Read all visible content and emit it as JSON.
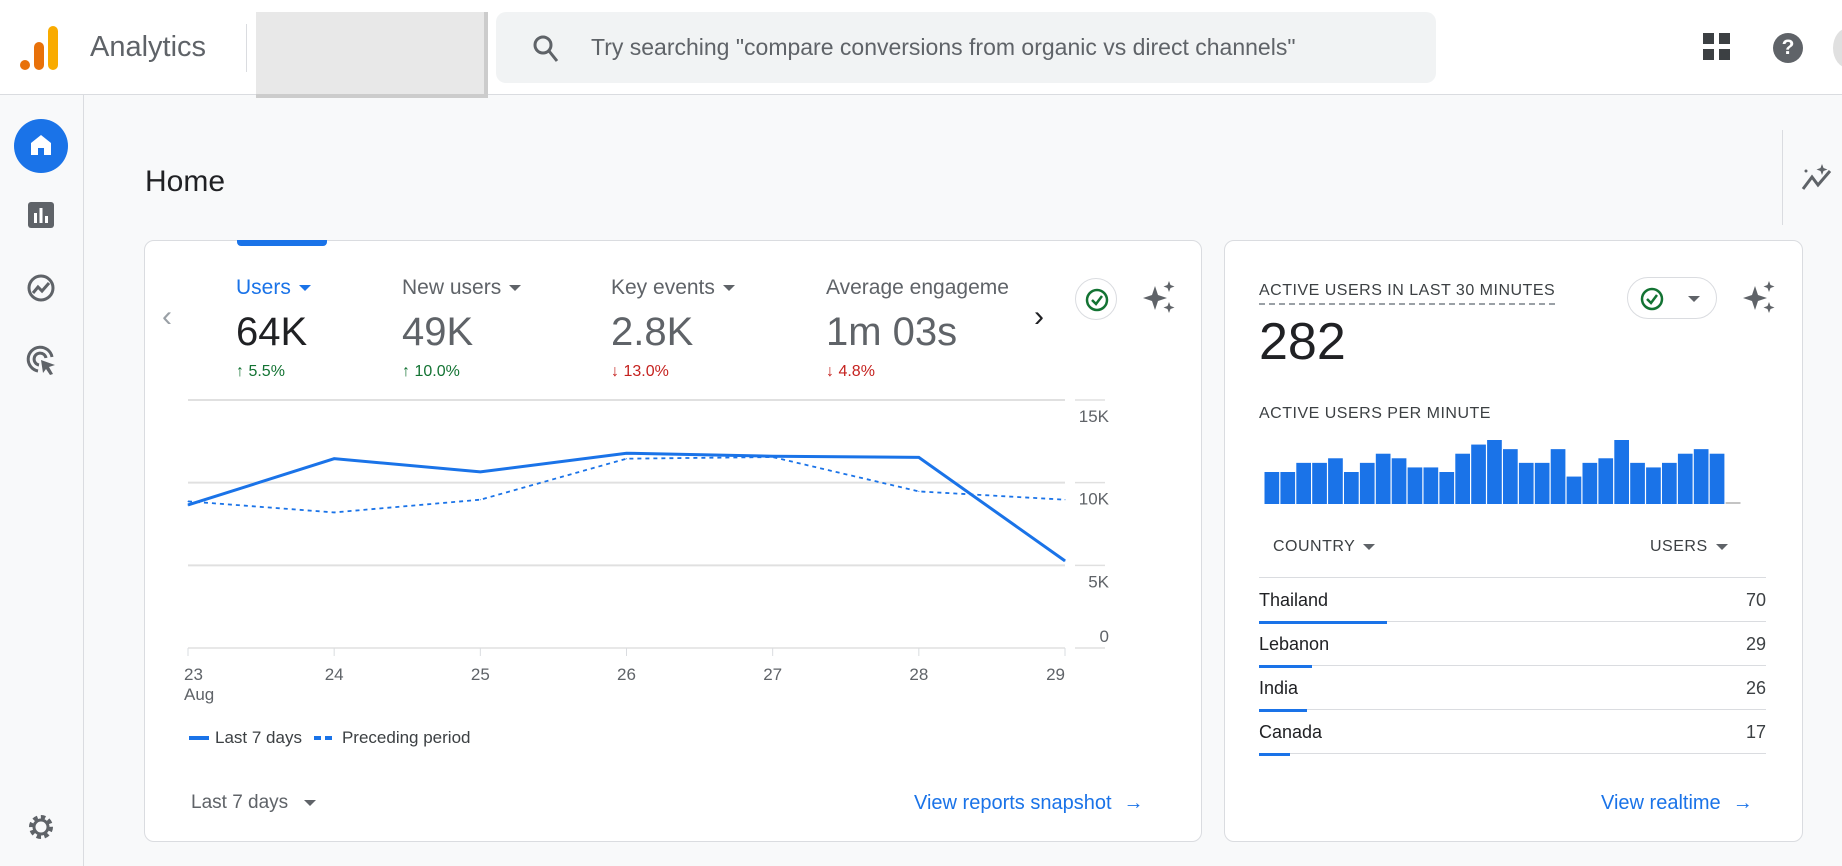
{
  "header": {
    "app_name": "Analytics",
    "search_placeholder": "Try searching \"compare conversions from organic vs direct channels\"",
    "icons": [
      "analytics-logo",
      "search-icon",
      "apps-grid-icon",
      "help-icon",
      "avatar"
    ]
  },
  "sidebar": {
    "items": [
      "home",
      "reports",
      "explore",
      "advertising",
      "admin-settings"
    ]
  },
  "page": {
    "title": "Home"
  },
  "overview_card": {
    "metrics": [
      {
        "label": "Users",
        "value": "64K",
        "change": "5.5%",
        "direction": "up",
        "selected": true
      },
      {
        "label": "New users",
        "value": "49K",
        "change": "10.0%",
        "direction": "up"
      },
      {
        "label": "Key events",
        "value": "2.8K",
        "change": "13.0%",
        "direction": "down"
      },
      {
        "label": "Average engageme",
        "value": "1m 03s",
        "change": "4.8%",
        "direction": "down"
      }
    ],
    "date_range": "Last 7 days",
    "link": "View reports snapshot"
  },
  "chart_data": {
    "type": "line",
    "x": [
      "23",
      "24",
      "25",
      "26",
      "27",
      "28",
      "29"
    ],
    "x_sublabel": "Aug",
    "y_ticks": [
      "0",
      "5K",
      "10K",
      "15K"
    ],
    "ylim": [
      0,
      15000
    ],
    "grid": true,
    "legend_position": "bottom-left",
    "series": [
      {
        "name": "Last 7 days",
        "style": "solid",
        "values": [
          8650,
          11450,
          10650,
          11780,
          11600,
          11530,
          5270
        ]
      },
      {
        "name": "Preceding period",
        "style": "dashed",
        "values": [
          8870,
          8200,
          8970,
          11450,
          11550,
          9470,
          8970
        ]
      }
    ],
    "colors": {
      "line": "#1a73e8",
      "grid": "#e0e0e0"
    }
  },
  "realtime_card": {
    "title": "ACTIVE USERS IN LAST 30 MINUTES",
    "value": "282",
    "per_minute_label": "ACTIVE USERS PER MINUTE",
    "per_minute": [
      7,
      7,
      9,
      9,
      10,
      7,
      9,
      11,
      10,
      8,
      8,
      7,
      11,
      13,
      14,
      12,
      9,
      9,
      12,
      6,
      9,
      10,
      14,
      9,
      8,
      9,
      11,
      12,
      11,
      0
    ],
    "col_country": "COUNTRY",
    "col_users": "USERS",
    "rows": [
      {
        "country": "Thailand",
        "users": "70",
        "value": 70
      },
      {
        "country": "Lebanon",
        "users": "29",
        "value": 29
      },
      {
        "country": "India",
        "users": "26",
        "value": 26
      },
      {
        "country": "Canada",
        "users": "17",
        "value": 17
      }
    ],
    "link": "View realtime"
  },
  "colors": {
    "accent": "#1a73e8",
    "up": "#137333",
    "down": "#c5221f",
    "logo_orange": "#e8710a",
    "logo_yellow": "#f9ab00"
  }
}
